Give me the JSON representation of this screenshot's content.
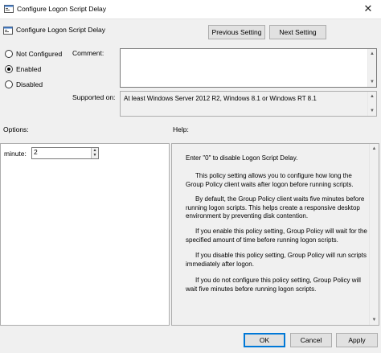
{
  "window": {
    "title": "Configure Logon Script Delay",
    "close_glyph": "✕"
  },
  "header": {
    "title": "Configure Logon Script Delay",
    "previous_label": "Previous Setting",
    "next_label": "Next Setting"
  },
  "state": {
    "options": [
      {
        "label": "Not Configured",
        "checked": false
      },
      {
        "label": "Enabled",
        "checked": true
      },
      {
        "label": "Disabled",
        "checked": false
      }
    ]
  },
  "comment": {
    "label": "Comment:",
    "value": ""
  },
  "supported": {
    "label": "Supported on:",
    "value": "At least Windows Server 2012 R2, Windows 8.1 or Windows RT 8.1"
  },
  "options_section": {
    "label": "Options:",
    "minute_label": "minute:",
    "minute_value": "2"
  },
  "help_section": {
    "label": "Help:",
    "paragraphs": [
      "Enter \"0\" to disable Logon Script Delay.",
      "This policy setting allows you to configure how long the Group Policy client waits after logon before running scripts.",
      "By default, the Group Policy client waits five minutes before running logon scripts. This helps create a responsive desktop environment by preventing disk contention.",
      "If you enable this policy setting, Group Policy will wait for the specified amount of time before running logon scripts.",
      "If you disable this policy setting, Group Policy will run scripts immediately after logon.",
      "If you do not configure this policy setting, Group Policy will wait five minutes before running logon scripts."
    ]
  },
  "footer": {
    "ok_label": "OK",
    "cancel_label": "Cancel",
    "apply_label": "Apply"
  },
  "icons": {
    "up_arrow": "▲",
    "down_arrow": "▼"
  }
}
